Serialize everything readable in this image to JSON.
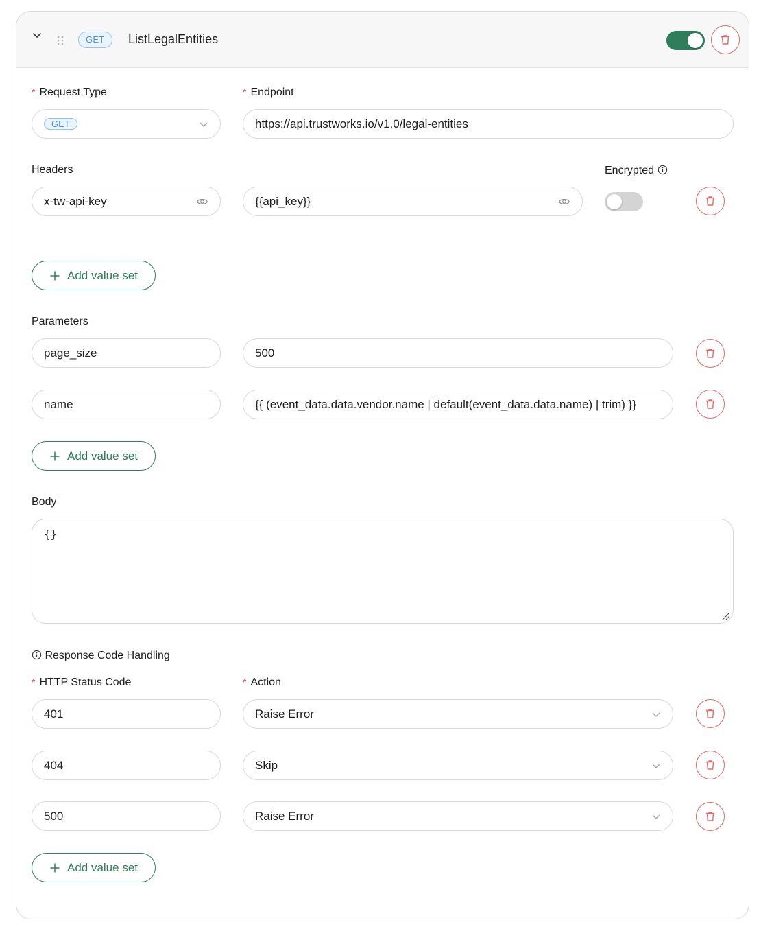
{
  "header": {
    "method_badge": "GET",
    "title": "ListLegalEntities",
    "enabled": true
  },
  "request": {
    "type_label": "Request Type",
    "type_value": "GET",
    "endpoint_label": "Endpoint",
    "endpoint_value": "https://api.trustworks.io/v1.0/legal-entities"
  },
  "headers": {
    "label": "Headers",
    "encrypted_label": "Encrypted",
    "rows": [
      {
        "key": "x-tw-api-key",
        "value": "{{api_key}}",
        "encrypted": false
      }
    ],
    "add_label": "Add value set"
  },
  "parameters": {
    "label": "Parameters",
    "rows": [
      {
        "key": "page_size",
        "value": "500"
      },
      {
        "key": "name",
        "value": "{{ (event_data.data.vendor.name | default(event_data.data.name) | trim) }}"
      }
    ],
    "add_label": "Add value set"
  },
  "body": {
    "label": "Body",
    "value": "{}"
  },
  "response": {
    "section_label": "Response Code Handling",
    "status_label": "HTTP Status Code",
    "action_label": "Action",
    "rows": [
      {
        "code": "401",
        "action": "Raise Error"
      },
      {
        "code": "404",
        "action": "Skip"
      },
      {
        "code": "500",
        "action": "Raise Error"
      }
    ],
    "add_label": "Add value set"
  },
  "colors": {
    "accent": "#2f7d5b",
    "danger": "#e26a6a",
    "badge": "#4a90d6"
  }
}
